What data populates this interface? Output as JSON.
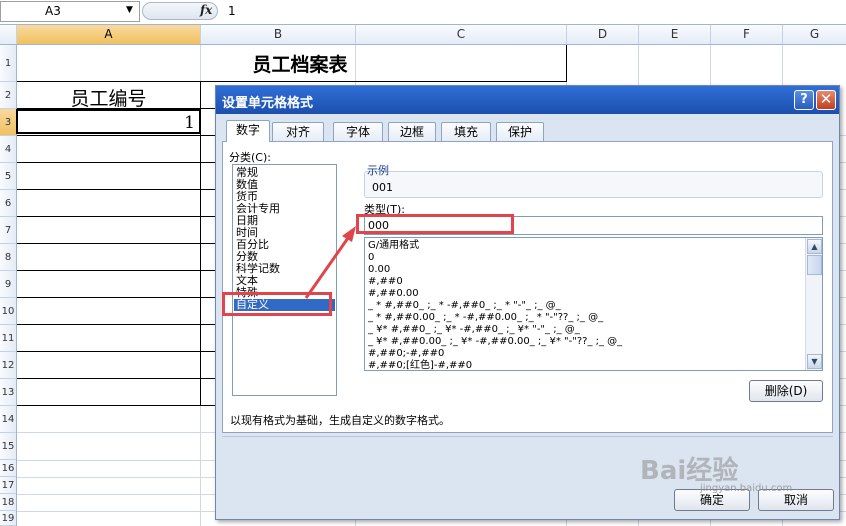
{
  "formula_bar": {
    "name_box": "A3",
    "fx": "fx",
    "value": "1"
  },
  "columns": [
    "A",
    "B",
    "C",
    "D",
    "E",
    "F",
    "G"
  ],
  "rows": [
    "1",
    "2",
    "3",
    "4",
    "5",
    "6",
    "7",
    "8",
    "9",
    "10",
    "11",
    "12",
    "13",
    "14",
    "15",
    "16",
    "17",
    "18",
    "19"
  ],
  "sheet": {
    "title": "员工档案表",
    "a2": "员工编号",
    "a3": "1"
  },
  "dialog": {
    "title": "设置单元格格式",
    "help": "?",
    "close": "✕",
    "tabs": [
      "数字",
      "对齐",
      "字体",
      "边框",
      "填充",
      "保护"
    ],
    "category_label": "分类(C):",
    "categories": [
      "常规",
      "数值",
      "货币",
      "会计专用",
      "日期",
      "时间",
      "百分比",
      "分数",
      "科学记数",
      "文本",
      "特殊",
      "自定义"
    ],
    "selected_category": "自定义",
    "sample_label": "示例",
    "sample_value": "001",
    "type_label": "类型(T):",
    "type_value": "000",
    "formats": [
      "G/通用格式",
      "0",
      "0.00",
      "#,##0",
      "#,##0.00",
      "_ * #,##0_ ;_ * -#,##0_ ;_ * \"-\"_ ;_ @_",
      "_ * #,##0.00_ ;_ * -#,##0.00_ ;_ * \"-\"??_ ;_ @_",
      "_ ¥* #,##0_ ;_ ¥* -#,##0_ ;_ ¥* \"-\"_ ;_ @_",
      "_ ¥* #,##0.00_ ;_ ¥* -#,##0.00_ ;_ ¥* \"-\"??_ ;_ @_",
      "#,##0;-#,##0",
      "#,##0;[红色]-#,##0"
    ],
    "delete_label": "删除(D)",
    "hint": "以现有格式为基础，生成自定义的数字格式。",
    "ok_label": "确定",
    "cancel_label": "取消"
  },
  "watermark": {
    "text": "Bai经验",
    "sub": "jingyan.baidu.com"
  },
  "colors": {
    "titlebar": "#2f6fd6",
    "selection": "#316ac5",
    "annotation": "#e0454b"
  }
}
